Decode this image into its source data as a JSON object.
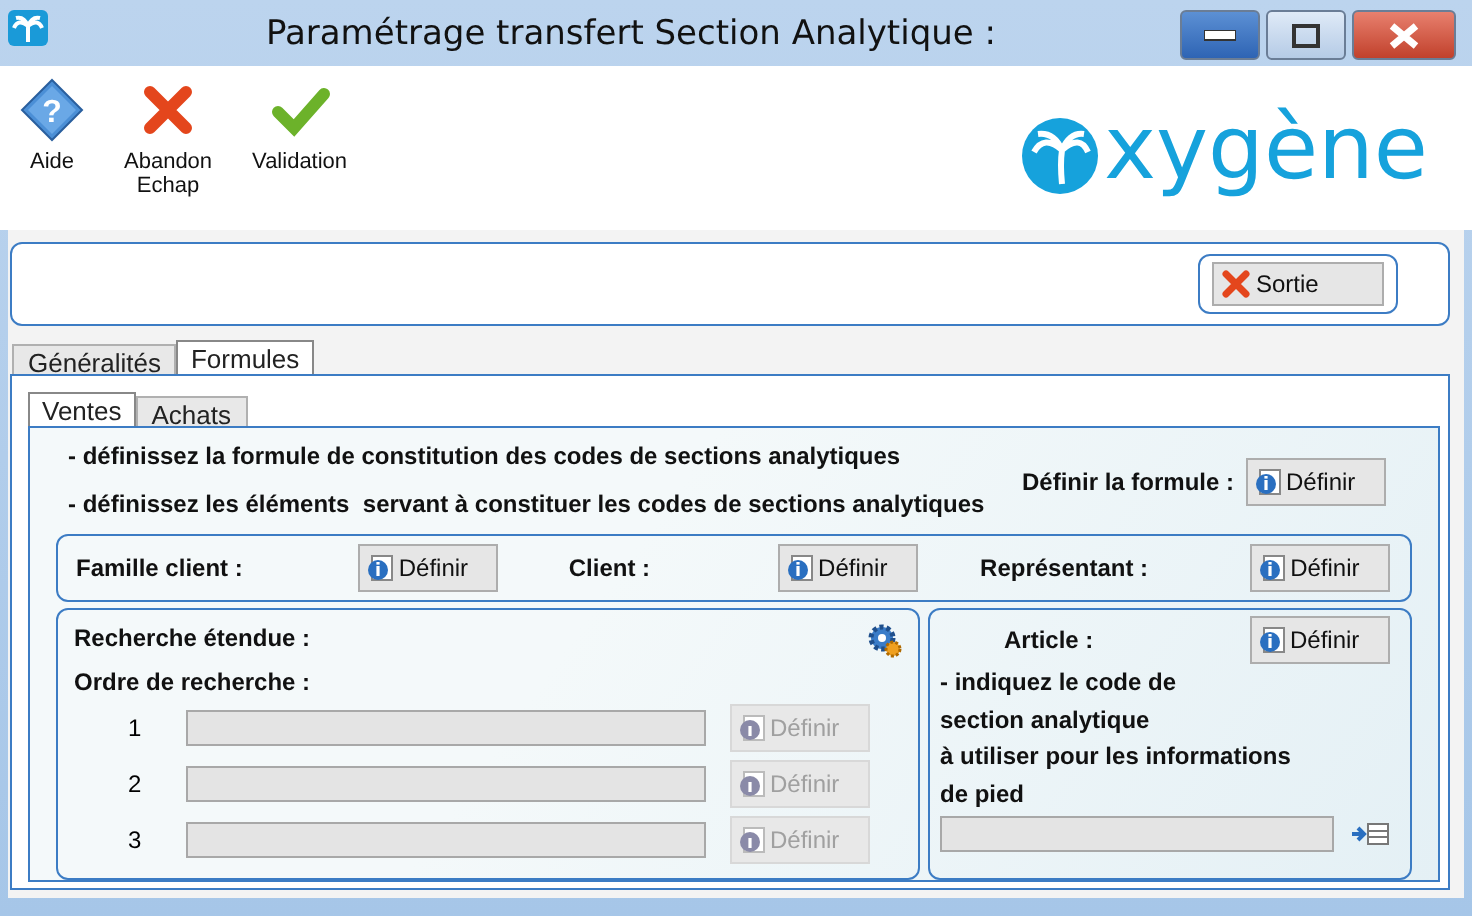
{
  "window": {
    "title": "Paramétrage transfert Section Analytique :"
  },
  "toolbar": [
    {
      "kind": "help",
      "symbol": "?",
      "lines": [
        "Aide"
      ]
    },
    {
      "kind": "cancel",
      "lines": [
        "Abandon",
        "Echap"
      ]
    },
    {
      "kind": "validate",
      "lines": [
        "Validation"
      ]
    }
  ],
  "logo": {
    "text": "xygène"
  },
  "exit_button": {
    "label": "Sortie"
  },
  "tabs": [
    {
      "label": "Généralités",
      "selected": false
    },
    {
      "label": "Formules",
      "selected": true
    }
  ],
  "subtabs": [
    {
      "label": "Ventes",
      "selected": true
    },
    {
      "label": "Achats",
      "selected": false
    }
  ],
  "instructions": [
    "- définissez la formule de constitution des codes de sections analytiques",
    "- définissez les éléments  servant à constituer les codes de sections analytiques"
  ],
  "formula": {
    "label": "Définir la formule :",
    "button": "Définir"
  },
  "elements": [
    {
      "label": "Famille client :",
      "button": "Définir"
    },
    {
      "label": "Client :",
      "button": "Définir"
    },
    {
      "label": "Représentant :",
      "button": "Définir"
    }
  ],
  "search": {
    "title": "Recherche étendue :",
    "order_label": "Ordre de recherche :",
    "rows": [
      {
        "number": "1",
        "button": "Définir",
        "disabled": true
      },
      {
        "number": "2",
        "button": "Définir",
        "disabled": true
      },
      {
        "number": "3",
        "button": "Définir",
        "disabled": true
      }
    ]
  },
  "article": {
    "label": "Article :",
    "button": "Définir",
    "description": [
      "- indiquez le code de",
      "section analytique",
      "à utiliser pour les informations",
      "de pied"
    ],
    "field_disabled": true
  }
}
